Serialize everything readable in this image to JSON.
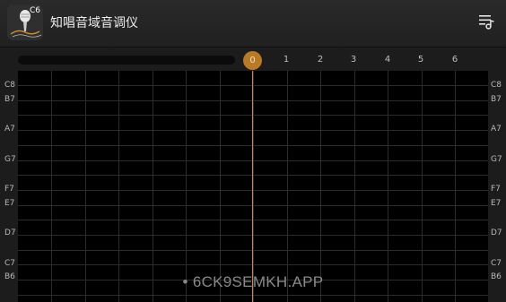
{
  "app": {
    "title": "知唱音域音调仪",
    "logo_note": "C6"
  },
  "header": {
    "menu_icon": "playlist-music-icon"
  },
  "timeline": {
    "playhead_label": "0",
    "ticks": [
      "0",
      "1",
      "2",
      "3",
      "4",
      "5",
      "6"
    ],
    "progress": 0
  },
  "grid": {
    "note_labels": [
      "C8",
      "B7",
      "A7",
      "G7",
      "F7",
      "E7",
      "D7",
      "C7",
      "B6"
    ]
  },
  "watermark": "• 6CK9SEMKH.APP",
  "colors": {
    "accent": "#c9841c",
    "playhead": "#d48a2a",
    "background": "#000000",
    "header": "#242424"
  }
}
